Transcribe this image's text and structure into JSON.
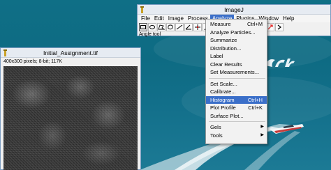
{
  "imagej": {
    "title": "ImageJ",
    "menus": [
      "File",
      "Edit",
      "Image",
      "Process",
      "Analyze",
      "Plugins",
      "Window",
      "Help"
    ],
    "active_menu": "Analyze",
    "status": "Angle tool",
    "tools": [
      "rectangle-tool",
      "oval-tool",
      "polygon-tool",
      "freehand-tool",
      "straight-line-tool",
      "angle-tool",
      "point-tool",
      "wand-tool",
      "text-tool",
      "magnifier-tool",
      "scrolling-tool",
      "color-picker-tool",
      "brush-tool",
      "flood-fill-tool",
      "arrow-tool",
      "more-tools"
    ]
  },
  "image_window": {
    "title": "Initial_Assignment.tif",
    "info": "400x300 pixels; 8-bit; 117K"
  },
  "analyze_menu": {
    "groups": [
      [
        {
          "label": "Measure",
          "shortcut": "Ctrl+M"
        },
        {
          "label": "Analyze Particles...",
          "shortcut": ""
        },
        {
          "label": "Summarize",
          "shortcut": ""
        },
        {
          "label": "Distribution...",
          "shortcut": ""
        },
        {
          "label": "Label",
          "shortcut": ""
        },
        {
          "label": "Clear Results",
          "shortcut": ""
        },
        {
          "label": "Set Measurements...",
          "shortcut": ""
        }
      ],
      [
        {
          "label": "Set Scale...",
          "shortcut": ""
        },
        {
          "label": "Calibrate...",
          "shortcut": ""
        },
        {
          "label": "Histogram",
          "shortcut": "Ctrl+H",
          "highlighted": true
        },
        {
          "label": "Plot Profile",
          "shortcut": "Ctrl+K"
        },
        {
          "label": "Surface Plot...",
          "shortcut": ""
        }
      ],
      [
        {
          "label": "Gels",
          "shortcut": "",
          "submenu": true
        },
        {
          "label": "Tools",
          "shortcut": "",
          "submenu": true
        }
      ]
    ]
  },
  "colors": {
    "highlight": "#3b6fc9",
    "desktop": "#0f6f86"
  }
}
